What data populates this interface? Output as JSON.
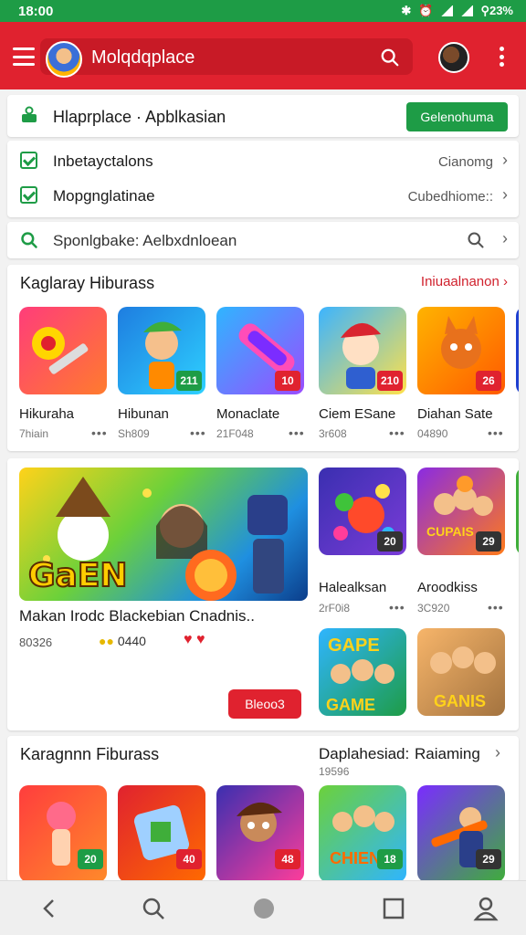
{
  "status_bar": {
    "time": "18:00",
    "battery": "⚲23%"
  },
  "app_bar": {
    "title": "Molqdqplace"
  },
  "store_row": {
    "title": "Hlaprplace · Apblkasian",
    "button_label": "Gelenohuma"
  },
  "options": [
    {
      "label": "Inbetayctalons",
      "value": "Cianomg"
    },
    {
      "label": "Mopgnglatinae",
      "value": "Cubedhiome::"
    }
  ],
  "search": {
    "text": "Sponlgbake: Aelbxdnloean"
  },
  "section1": {
    "title": "Kaglaray Hiburass",
    "link": "Iniuaalnanon",
    "apps": [
      {
        "name": "Hikuraha",
        "meta": "7hiain",
        "badge": "",
        "badge_color": ""
      },
      {
        "name": "Hibunan",
        "meta": "Sh809",
        "badge": "211",
        "badge_color": "#1e9c46"
      },
      {
        "name": "Monaclate",
        "meta": "21F048",
        "badge": "10",
        "badge_color": "#e0222f"
      },
      {
        "name": "Ciem ESane",
        "meta": "3r608",
        "badge": "210",
        "badge_color": "#e0222f"
      },
      {
        "name": "Diahan Sate",
        "meta": "04890",
        "badge": "26",
        "badge_color": "#e0222f"
      }
    ]
  },
  "section2": {
    "banner_word": "GaEN",
    "banner_caption": "Makan Irodc Blackebian Cnadnis..",
    "banner_meta": "80326",
    "coins": "0440",
    "hearts": "♥ ♥",
    "button_label": "Bleoo3",
    "apps": [
      {
        "name": "Halealksan",
        "meta": "2rF0i8",
        "badge": "20",
        "badge_color": "#333333"
      },
      {
        "name": "Aroodkiss",
        "meta": "3C920",
        "badge": "29",
        "badge_color": "#333333"
      }
    ],
    "tile_words": [
      "GAPE",
      "CUPAIS",
      "GAME",
      "GANIS"
    ]
  },
  "section3": {
    "title": "Karagnnn Fiburass",
    "subtitle": "Daplahesiad:",
    "link": "Raiaming",
    "meta": "19596",
    "tiles": [
      {
        "badge": "20",
        "badge_color": "#1e9c46"
      },
      {
        "badge": "40",
        "badge_color": "#e0222f"
      },
      {
        "badge": "48",
        "badge_color": "#e0222f"
      },
      {
        "badge": "18",
        "badge_color": "#1e9c46"
      },
      {
        "badge": "29",
        "badge_color": "#333333"
      }
    ],
    "tile_word": "CHIEN"
  },
  "colors": {
    "brand_red": "#e0222f",
    "brand_green": "#1e9c46"
  },
  "icons": [
    "menu-icon",
    "search-icon",
    "more-vert-icon",
    "store-icon",
    "check-icon",
    "chevron-right-icon",
    "back-icon",
    "home-icon",
    "recents-icon",
    "profile-icon"
  ]
}
